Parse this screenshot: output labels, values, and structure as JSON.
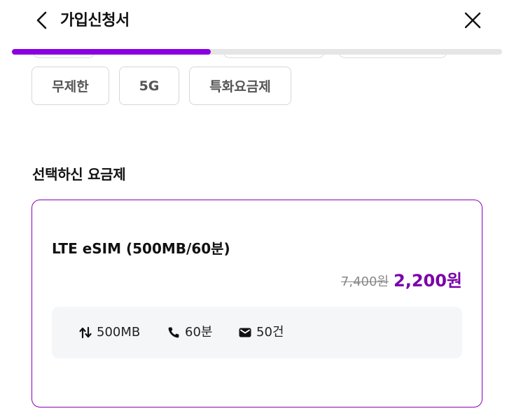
{
  "header": {
    "title": "가입신청서",
    "back_icon": "chevron-left-icon",
    "close_icon": "close-icon"
  },
  "progress": {
    "fraction": 0.406,
    "color": "#8a00e0",
    "track_color": "#e5e5e5"
  },
  "filter_chips": [
    {
      "label": "무제한"
    },
    {
      "label": "5G"
    },
    {
      "label": "특화요금제"
    }
  ],
  "selected_section": {
    "title": "선택하신 요금제"
  },
  "plan": {
    "name": "LTE eSIM (500MB/60분)",
    "original_price": "7,400원",
    "final_price": "2,200원",
    "accent_color": "#7a00a8",
    "features": [
      {
        "icon": "data-transfer-icon",
        "label": "500MB"
      },
      {
        "icon": "phone-icon",
        "label": "60분"
      },
      {
        "icon": "message-icon",
        "label": "50건"
      }
    ]
  }
}
